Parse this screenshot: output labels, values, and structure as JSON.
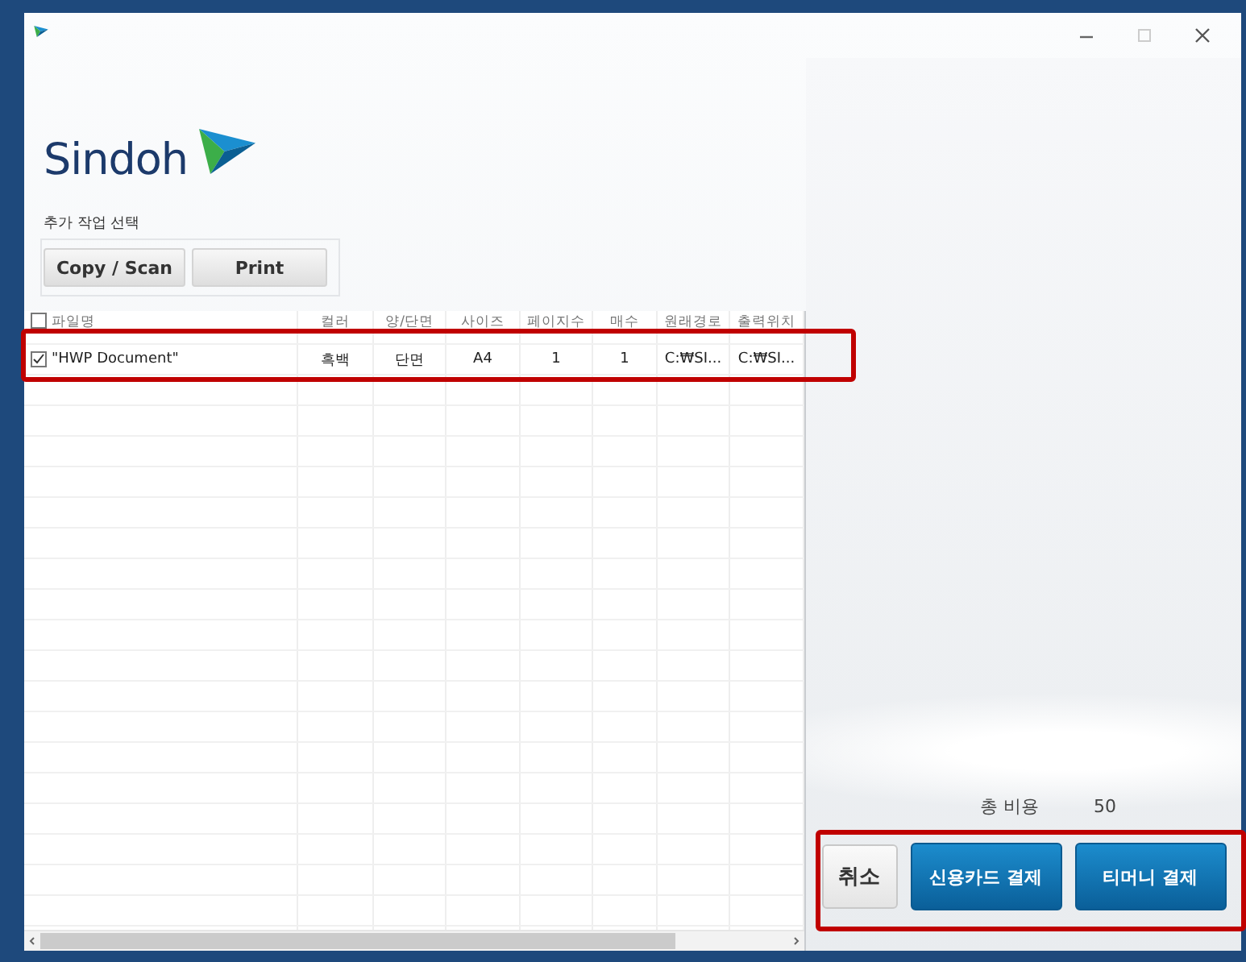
{
  "logo": {
    "text": "Sindoh"
  },
  "task_group": {
    "label": "추가 작업 선택",
    "buttons": [
      "Copy / Scan",
      "Print"
    ]
  },
  "table": {
    "header_checked": false,
    "columns": [
      "파일명",
      "컬러",
      "양/단면",
      "사이즈",
      "페이지수",
      "매수",
      "원래경로",
      "출력위치"
    ],
    "rows": [
      {
        "checked": true,
        "cells": [
          "\"HWP Document\"",
          "흑백",
          "단면",
          "A4",
          "1",
          "1",
          "C:₩SI...",
          "C:₩SI..."
        ]
      }
    ]
  },
  "total": {
    "label": "총 비용",
    "value": "50"
  },
  "actions": [
    {
      "label": "취소",
      "kind": "secondary"
    },
    {
      "label": "신용카드 결제",
      "kind": "primary"
    },
    {
      "label": "티머니 결제",
      "kind": "primary"
    }
  ]
}
